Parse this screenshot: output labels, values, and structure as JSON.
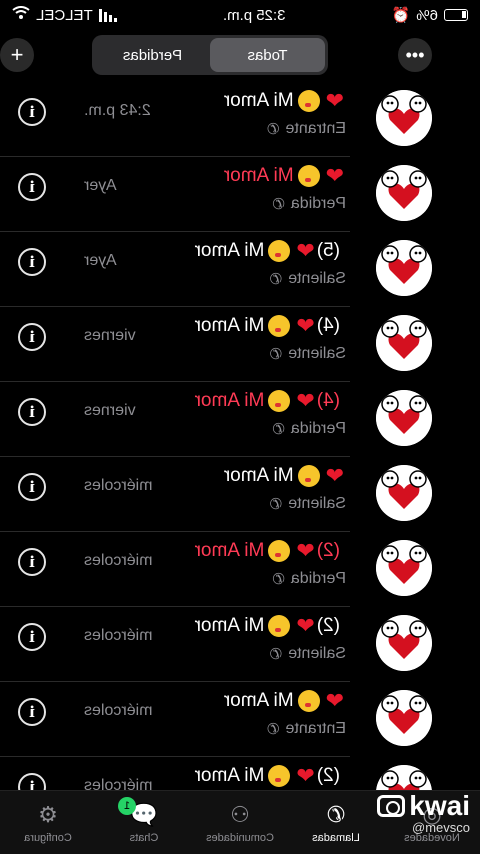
{
  "status_bar": {
    "carrier": "TELCEL",
    "time": "3:25 p.m.",
    "battery": "6%"
  },
  "topbar": {
    "segments": [
      {
        "label": "Todas",
        "active": true
      },
      {
        "label": "Perdidas",
        "active": false
      }
    ],
    "add_icon": "plus-icon",
    "more_icon": "ellipsis-icon"
  },
  "calls": [
    {
      "name": "Mi Amor",
      "count": "",
      "type": "Entrante",
      "time": "2:43 p.m.",
      "missed": false
    },
    {
      "name": "Mi Amor",
      "count": "",
      "type": "Perdida",
      "time": "Ayer",
      "missed": true
    },
    {
      "name": "Mi Amor",
      "count": "(5)",
      "type": "Saliente",
      "time": "Ayer",
      "missed": false
    },
    {
      "name": "Mi Amor",
      "count": "(4)",
      "type": "Saliente",
      "time": "viernes",
      "missed": false
    },
    {
      "name": "Mi Amor",
      "count": "(4)",
      "type": "Perdida",
      "time": "viernes",
      "missed": true
    },
    {
      "name": "Mi Amor",
      "count": "",
      "type": "Saliente",
      "time": "miércoles",
      "missed": false
    },
    {
      "name": "Mi Amor",
      "count": "(2)",
      "type": "Perdida",
      "time": "miércoles",
      "missed": true
    },
    {
      "name": "Mi Amor",
      "count": "(2)",
      "type": "Saliente",
      "time": "miércoles",
      "missed": false
    },
    {
      "name": "Mi Amor",
      "count": "",
      "type": "Entrante",
      "time": "miércoles",
      "missed": false
    },
    {
      "name": "Mi Amor",
      "count": "(2)",
      "type": "",
      "time": "miércoles",
      "missed": false
    }
  ],
  "tabbar": [
    {
      "label": "Novedades",
      "icon": "updates-icon",
      "active": false
    },
    {
      "label": "Llamadas",
      "icon": "phone-icon",
      "active": true
    },
    {
      "label": "Comunidades",
      "icon": "communities-icon",
      "active": false
    },
    {
      "label": "Chats",
      "icon": "chat-icon",
      "active": false,
      "badge": "1"
    },
    {
      "label": "Configura",
      "icon": "gear-icon",
      "active": false
    }
  ],
  "watermark": {
    "brand": "kwai",
    "handle": "@mevsco"
  },
  "colors": {
    "missed": "#ff3b55",
    "heart": "#e8192c",
    "badge": "#25d366",
    "muted": "#8e8e93"
  }
}
